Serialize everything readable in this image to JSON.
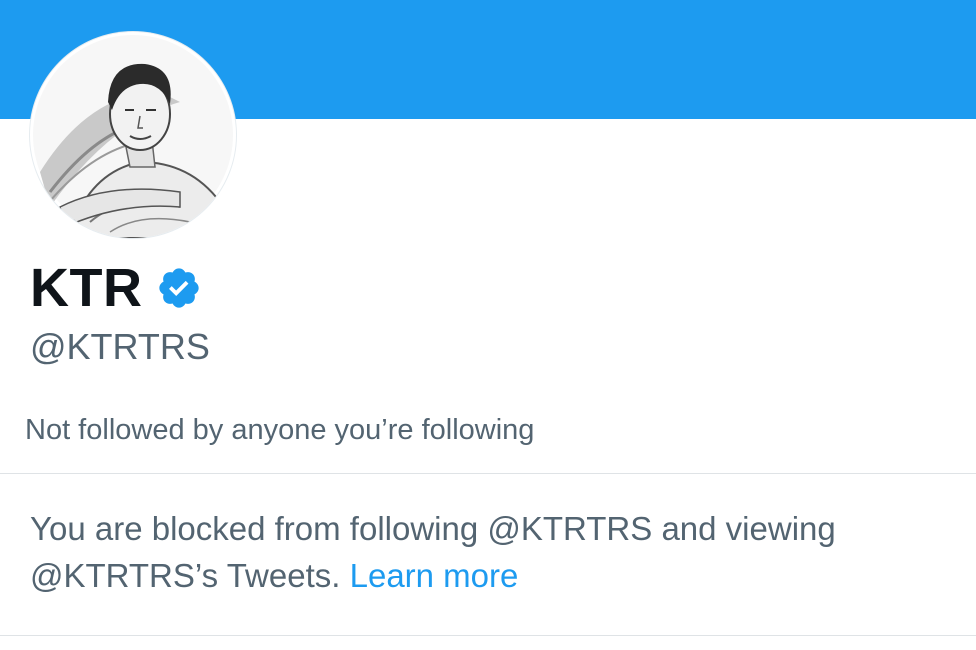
{
  "profile": {
    "display_name": "KTR",
    "handle": "@KTRTRS",
    "verified": true,
    "followers_note": "Not followed by anyone you’re following"
  },
  "blocked_notice": {
    "text": "You are blocked from following @KTRTRS and viewing @KTRTRS’s Tweets.",
    "link_label": "Learn more"
  },
  "colors": {
    "banner": "#1d9bf0",
    "primary_text": "#0f1419",
    "secondary_text": "#536471",
    "link": "#1d9bf0",
    "verified_badge": "#1d9bf0"
  }
}
